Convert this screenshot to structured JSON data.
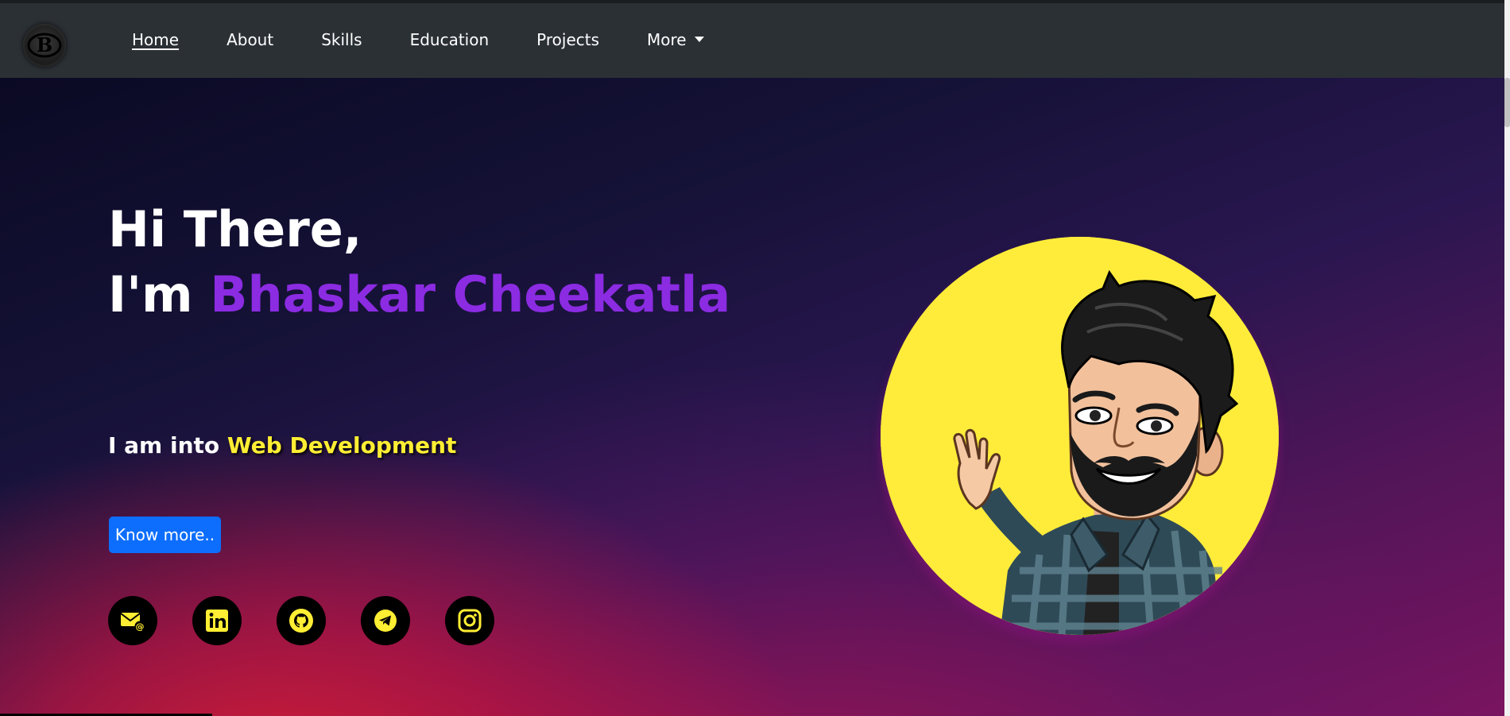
{
  "nav": {
    "logo_text": "B",
    "links": [
      {
        "label": "Home",
        "active": true
      },
      {
        "label": "About"
      },
      {
        "label": "Skills"
      },
      {
        "label": "Education"
      },
      {
        "label": "Projects"
      },
      {
        "label": "More",
        "dropdown": true
      }
    ]
  },
  "hero": {
    "greeting": "Hi There,",
    "im_prefix": "I'm ",
    "name": "Bhaskar Cheekatla",
    "sub_prefix": "I am into ",
    "sub_highlight": "Web Development",
    "button_label": "Know more..",
    "socials": [
      {
        "icon": "email-icon"
      },
      {
        "icon": "linkedin-icon"
      },
      {
        "icon": "github-icon"
      },
      {
        "icon": "telegram-icon"
      },
      {
        "icon": "instagram-icon"
      }
    ],
    "avatar": "cartoon-avatar-waving"
  },
  "colors": {
    "navbar": "#2b3035",
    "name_purple": "#8b2be2",
    "highlight_yellow": "#ffee33",
    "button_blue": "#0d6efd",
    "avatar_bg": "#ffec3a"
  }
}
